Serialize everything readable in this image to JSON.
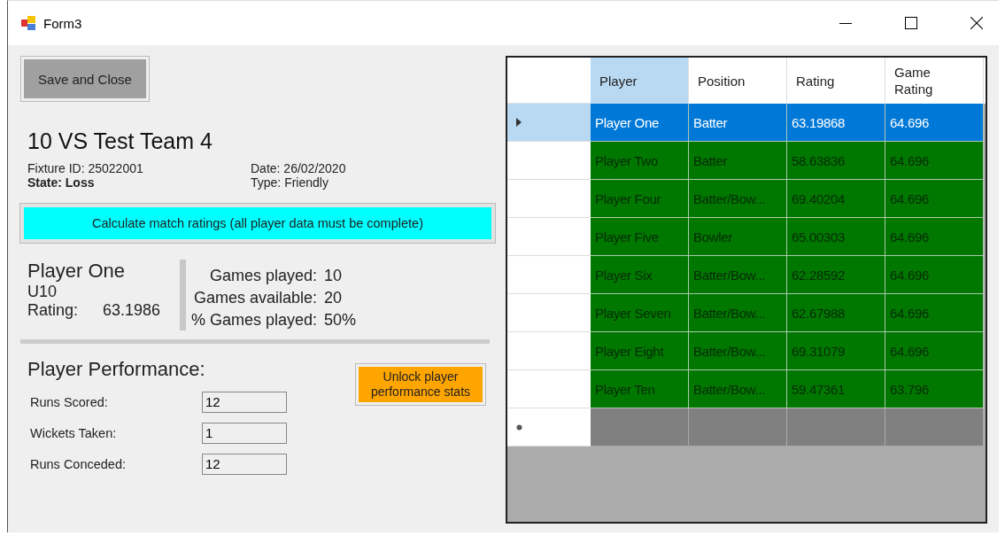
{
  "window": {
    "title": "Form3"
  },
  "save_button": "Save and Close",
  "fixture": {
    "title": "10 VS Test Team 4",
    "fixture_id": "Fixture ID: 25022001",
    "state_label": "State:",
    "state": "Loss",
    "date": "Date: 26/02/2020",
    "type": "Type: Friendly"
  },
  "calculate_button": "Calculate match ratings (all player data must be complete)",
  "player": {
    "name": "Player One",
    "age_group": "U10",
    "rating_label": "Rating:",
    "rating": "63.1986",
    "stats": [
      {
        "label": "Games played:",
        "value": "10"
      },
      {
        "label": "Games available:",
        "value": "20"
      },
      {
        "label": "% Games played:",
        "value": "50%"
      }
    ]
  },
  "performance": {
    "title": "Player Performance:",
    "unlock_button": "Unlock player performance stats",
    "fields": [
      {
        "label": "Runs Scored:",
        "value": "12"
      },
      {
        "label": "Wickets Taken:",
        "value": "1"
      },
      {
        "label": "Runs Conceded:",
        "value": "12"
      }
    ]
  },
  "table": {
    "columns": [
      {
        "label": "Player",
        "selected": true
      },
      {
        "label": "Position",
        "selected": false
      },
      {
        "label": "Rating",
        "selected": false
      },
      {
        "label": "Game Rating",
        "selected": false
      }
    ],
    "rows": [
      {
        "selected": true,
        "cells": [
          "Player One",
          "Batter",
          "63.19868",
          "64.696"
        ]
      },
      {
        "selected": false,
        "cells": [
          "Player Two",
          "Batter",
          "58.63836",
          "64.696"
        ]
      },
      {
        "selected": false,
        "cells": [
          "Player Four",
          "Batter/Bow...",
          "69.40204",
          "64.696"
        ]
      },
      {
        "selected": false,
        "cells": [
          "Player Five",
          "Bowler",
          "65.00303",
          "64.696"
        ]
      },
      {
        "selected": false,
        "cells": [
          "Player Six",
          "Batter/Bow...",
          "62.28592",
          "64.696"
        ]
      },
      {
        "selected": false,
        "cells": [
          "Player Seven",
          "Batter/Bow...",
          "62.67988",
          "64.696"
        ]
      },
      {
        "selected": false,
        "cells": [
          "Player Eight",
          "Batter/Bow...",
          "69.31079",
          "64.696"
        ]
      },
      {
        "selected": false,
        "cells": [
          "Player Ten",
          "Batter/Bow...",
          "59.47361",
          "63.796"
        ]
      }
    ]
  }
}
